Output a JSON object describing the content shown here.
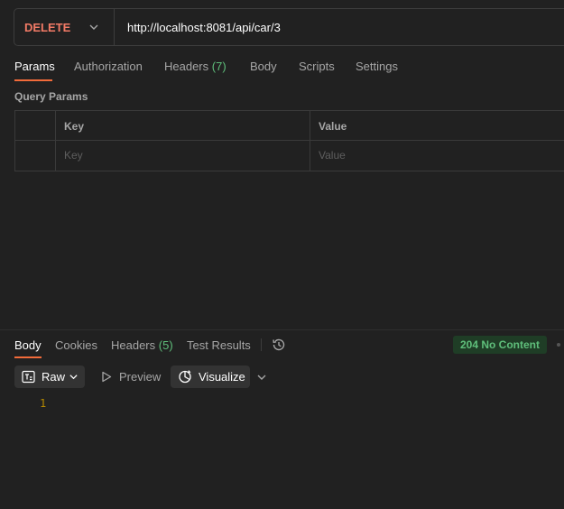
{
  "request": {
    "method": "DELETE",
    "url": "http://localhost:8081/api/car/3"
  },
  "request_tabs": [
    {
      "label": "Params",
      "active": true
    },
    {
      "label": "Authorization"
    },
    {
      "label": "Headers",
      "count": "(7)"
    },
    {
      "label": "Body"
    },
    {
      "label": "Scripts"
    },
    {
      "label": "Settings"
    }
  ],
  "query_params": {
    "title": "Query Params",
    "columns": [
      "Key",
      "Value"
    ],
    "placeholders": {
      "key": "Key",
      "value": "Value"
    }
  },
  "response_tabs": [
    {
      "label": "Body",
      "active": true
    },
    {
      "label": "Cookies"
    },
    {
      "label": "Headers",
      "count": "(5)"
    },
    {
      "label": "Test Results"
    }
  ],
  "status": {
    "text": "204 No Content",
    "color": "#5fbf7b"
  },
  "response_toolbar": {
    "format_label": "Raw",
    "preview_label": "Preview",
    "visualize_label": "Visualize"
  },
  "editor": {
    "lines": [
      "1"
    ]
  },
  "icons": {
    "method_dropdown": "chevron-down-icon",
    "history": "history-icon",
    "raw": "raw-format-icon",
    "preview": "play-icon",
    "visualize": "visualize-icon"
  },
  "colors": {
    "method": "#f27a66",
    "accent": "#f26b3a",
    "background": "#212121"
  }
}
